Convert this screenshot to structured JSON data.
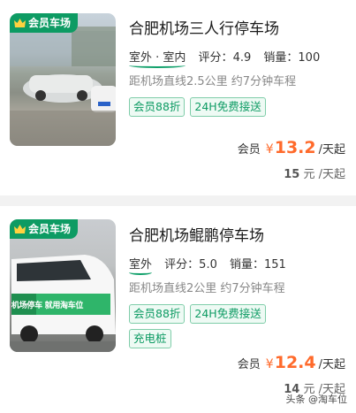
{
  "listings": [
    {
      "badge": "会员车场",
      "title": "合肥机场三人行停车场",
      "location_type": "室外 · 室内",
      "rating_label": "评分：",
      "rating": "4.9",
      "sales_label": "销量：",
      "sales": "100",
      "distance": "距机场直线2.5公里 约7分钟车程",
      "tags": [
        "会员88折",
        "24H免费接送"
      ],
      "member_label": "会员",
      "currency": "¥",
      "member_price": "13.2",
      "price_unit": "/天起",
      "original_price": "15",
      "original_unit": "元 /天起"
    },
    {
      "badge": "会员车场",
      "title": "合肥机场鲲鹏停车场",
      "location_type": "室外",
      "rating_label": "评分：",
      "rating": "5.0",
      "sales_label": "销量：",
      "sales": "151",
      "distance": "距机场直线2公里 约7分钟车程",
      "tags": [
        "会员88折",
        "24H免费接送",
        "充电桩"
      ],
      "van_text": "机场停车 就用淘车位",
      "member_label": "会员",
      "currency": "¥",
      "member_price": "12.4",
      "price_unit": "/天起",
      "original_price": "14",
      "original_unit": "元 /天起"
    }
  ],
  "watermark": "头条 @淘车位",
  "colors": {
    "brand_green": "#0d9b63",
    "price_orange": "#ff6a2b"
  }
}
